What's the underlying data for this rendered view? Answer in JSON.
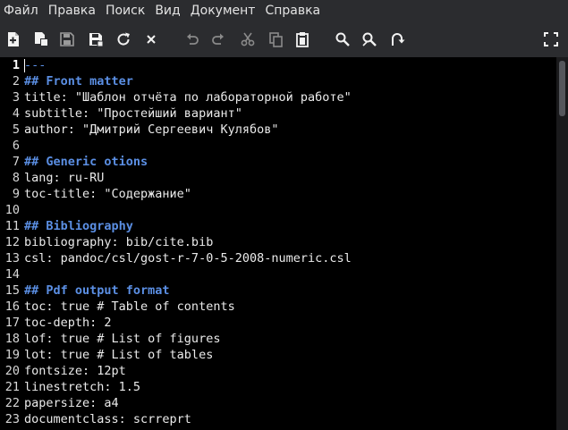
{
  "menu": [
    "Файл",
    "Правка",
    "Поиск",
    "Вид",
    "Документ",
    "Справка"
  ],
  "toolbar": {
    "new": "new-document-icon",
    "open": "new-window-icon",
    "save": "save-icon",
    "save_all": "save-all-icon",
    "reload": "reload-icon",
    "close": "close-icon",
    "undo": "undo-icon",
    "redo": "redo-icon",
    "cut": "cut-icon",
    "copy": "copy-icon",
    "paste": "paste-icon",
    "find": "search-icon",
    "replace": "find-replace-icon",
    "goto": "go-to-icon",
    "fullscreen": "fullscreen-icon"
  },
  "editor": {
    "lines": [
      {
        "n": "1",
        "text": "---",
        "style": "rule"
      },
      {
        "n": "2",
        "text": "## Front matter",
        "style": "heading"
      },
      {
        "n": "3",
        "text": "title: \"Шаблон отчёта по лабораторной работе\"",
        "style": "code"
      },
      {
        "n": "4",
        "text": "subtitle: \"Простейший вариант\"",
        "style": "code"
      },
      {
        "n": "5",
        "text": "author: \"Дмитрий Сергеевич Кулябов\"",
        "style": "code"
      },
      {
        "n": "6",
        "text": "",
        "style": "code"
      },
      {
        "n": "7",
        "text": "## Generic otions",
        "style": "heading"
      },
      {
        "n": "8",
        "text": "lang: ru-RU",
        "style": "code"
      },
      {
        "n": "9",
        "text": "toc-title: \"Содержание\"",
        "style": "code"
      },
      {
        "n": "10",
        "text": "",
        "style": "code"
      },
      {
        "n": "11",
        "text": "## Bibliography",
        "style": "heading"
      },
      {
        "n": "12",
        "text": "bibliography: bib/cite.bib",
        "style": "code"
      },
      {
        "n": "13",
        "text": "csl: pandoc/csl/gost-r-7-0-5-2008-numeric.csl",
        "style": "code"
      },
      {
        "n": "14",
        "text": "",
        "style": "code"
      },
      {
        "n": "15",
        "text": "## Pdf output format",
        "style": "heading"
      },
      {
        "n": "16",
        "text": "toc: true # Table of contents",
        "style": "code"
      },
      {
        "n": "17",
        "text": "toc-depth: 2",
        "style": "code"
      },
      {
        "n": "18",
        "text": "lof: true # List of figures",
        "style": "code"
      },
      {
        "n": "19",
        "text": "lot: true # List of tables",
        "style": "code"
      },
      {
        "n": "20",
        "text": "fontsize: 12pt",
        "style": "code"
      },
      {
        "n": "21",
        "text": "linestretch: 1.5",
        "style": "code"
      },
      {
        "n": "22",
        "text": "papersize: a4",
        "style": "code"
      },
      {
        "n": "23",
        "text": "documentclass: scrreprt",
        "style": "code"
      }
    ]
  }
}
